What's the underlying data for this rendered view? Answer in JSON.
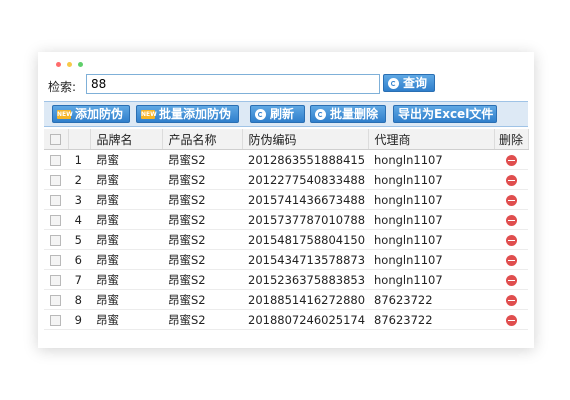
{
  "colors": {
    "dot_red": "#ff6b6b",
    "dot_yellow": "#f7c948",
    "dot_green": "#5fcf6b",
    "accent": "#2f7fcc",
    "delete": "#e04e4e"
  },
  "search": {
    "label": "检索:",
    "value": "88",
    "button_label": "查询",
    "button_icon": "refresh-icon"
  },
  "toolbar": {
    "add_label": "添加防伪",
    "batch_add_label": "批量添加防伪",
    "refresh_label": "刷新",
    "batch_delete_label": "批量删除",
    "export_label": "导出为Excel文件",
    "new_badge": "NEW"
  },
  "table": {
    "headers": {
      "brand": "品牌名",
      "product": "产品名称",
      "code": "防伪编码",
      "agent": "代理商",
      "delete": "删除"
    },
    "rows": [
      {
        "num": "1",
        "brand": "昂蜜",
        "product": "昂蜜S2",
        "code": "2012863551888415",
        "agent": "hongln1107"
      },
      {
        "num": "2",
        "brand": "昂蜜",
        "product": "昂蜜S2",
        "code": "2012277540833488",
        "agent": "hongln1107"
      },
      {
        "num": "3",
        "brand": "昂蜜",
        "product": "昂蜜S2",
        "code": "2015741436673488",
        "agent": "hongln1107"
      },
      {
        "num": "4",
        "brand": "昂蜜",
        "product": "昂蜜S2",
        "code": "2015737787010788",
        "agent": "hongln1107"
      },
      {
        "num": "5",
        "brand": "昂蜜",
        "product": "昂蜜S2",
        "code": "2015481758804150",
        "agent": "hongln1107"
      },
      {
        "num": "6",
        "brand": "昂蜜",
        "product": "昂蜜S2",
        "code": "2015434713578873",
        "agent": "hongln1107"
      },
      {
        "num": "7",
        "brand": "昂蜜",
        "product": "昂蜜S2",
        "code": "2015236375883853",
        "agent": "hongln1107"
      },
      {
        "num": "8",
        "brand": "昂蜜",
        "product": "昂蜜S2",
        "code": "2018851416272880",
        "agent": "87623722"
      },
      {
        "num": "9",
        "brand": "昂蜜",
        "product": "昂蜜S2",
        "code": "2018807246025174",
        "agent": "87623722"
      }
    ]
  }
}
